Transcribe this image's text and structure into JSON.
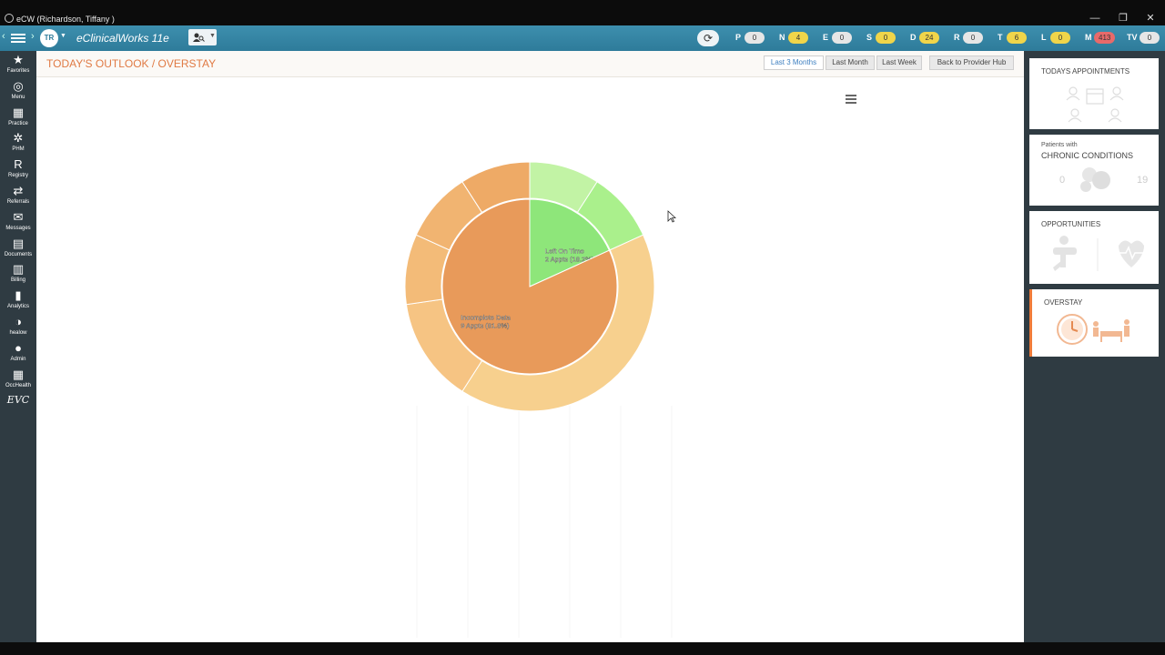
{
  "window": {
    "title": "eCW (Richardson, Tiffany )",
    "minimize": "—",
    "restore": "❐",
    "close": "✕"
  },
  "topbar": {
    "avatar_initials": "TR",
    "brand": "eClinicalWorks 11e",
    "counters": [
      {
        "letter": "P",
        "value": "0",
        "color": "#e6e6e6"
      },
      {
        "letter": "N",
        "value": "4",
        "color": "#f0d54a"
      },
      {
        "letter": "E",
        "value": "0",
        "color": "#e6e6e6"
      },
      {
        "letter": "S",
        "value": "0",
        "color": "#f0d54a"
      },
      {
        "letter": "D",
        "value": "24",
        "color": "#f0d54a"
      },
      {
        "letter": "R",
        "value": "0",
        "color": "#e6e6e6"
      },
      {
        "letter": "T",
        "value": "6",
        "color": "#f0d54a"
      },
      {
        "letter": "L",
        "value": "0",
        "color": "#f0d54a"
      },
      {
        "letter": "M",
        "value": "413",
        "color": "#e86a6a"
      },
      {
        "letter": "TV",
        "value": "0",
        "color": "#e6e6e6"
      }
    ]
  },
  "leftnav": [
    {
      "icon": "★",
      "label": "Favorites"
    },
    {
      "icon": "◎",
      "label": "Menu"
    },
    {
      "icon": "▦",
      "label": "Practice"
    },
    {
      "icon": "✲",
      "label": "PHM"
    },
    {
      "icon": "R",
      "label": "Registry"
    },
    {
      "icon": "⇄",
      "label": "Referrals"
    },
    {
      "icon": "✉",
      "label": "Messages"
    },
    {
      "icon": "▤",
      "label": "Documents"
    },
    {
      "icon": "▥",
      "label": "Billing"
    },
    {
      "icon": "▮",
      "label": "Analytics"
    },
    {
      "icon": "◑",
      "label": "healow"
    },
    {
      "icon": "●",
      "label": "Admin"
    },
    {
      "icon": "▦",
      "label": "OccHealth"
    },
    {
      "icon": "EVC",
      "label": ""
    }
  ],
  "page": {
    "title": "TODAY'S OUTLOOK / OVERSTAY",
    "range_buttons": [
      "Last 3 Months",
      "Last Month",
      "Last Week"
    ],
    "active_range": "Last 3 Months",
    "back_button": "Back to Provider Hub"
  },
  "chart_data": {
    "type": "pie",
    "inner": [
      {
        "label": "Left On Time",
        "detail": "2 Appts (18.2%)",
        "value": 18.2,
        "color": "#8ee67a"
      },
      {
        "label": "Incomplete Data",
        "detail": "9 Appts (81.8%)",
        "value": 81.8,
        "color": "#e89a5a"
      }
    ],
    "outer": [
      {
        "value": 9.1,
        "color": "#c2f3a5"
      },
      {
        "value": 9.1,
        "color": "#aaf08c"
      },
      {
        "value": 40.9,
        "color": "#f7d08e"
      },
      {
        "value": 13.6,
        "color": "#f6c483"
      },
      {
        "value": 9.1,
        "color": "#f3bb78"
      },
      {
        "value": 9.1,
        "color": "#f1b471"
      },
      {
        "value": 9.1,
        "color": "#eeaa66"
      }
    ]
  },
  "rightpanel": {
    "appointments": "TODAYS APPOINTMENTS",
    "chronic_small": "Patients with",
    "chronic_main": "CHRONIC CONDITIONS",
    "chronic_left": "0",
    "chronic_right": "19",
    "opportunities": "OPPORTUNITIES",
    "overstay": "OVERSTAY"
  }
}
